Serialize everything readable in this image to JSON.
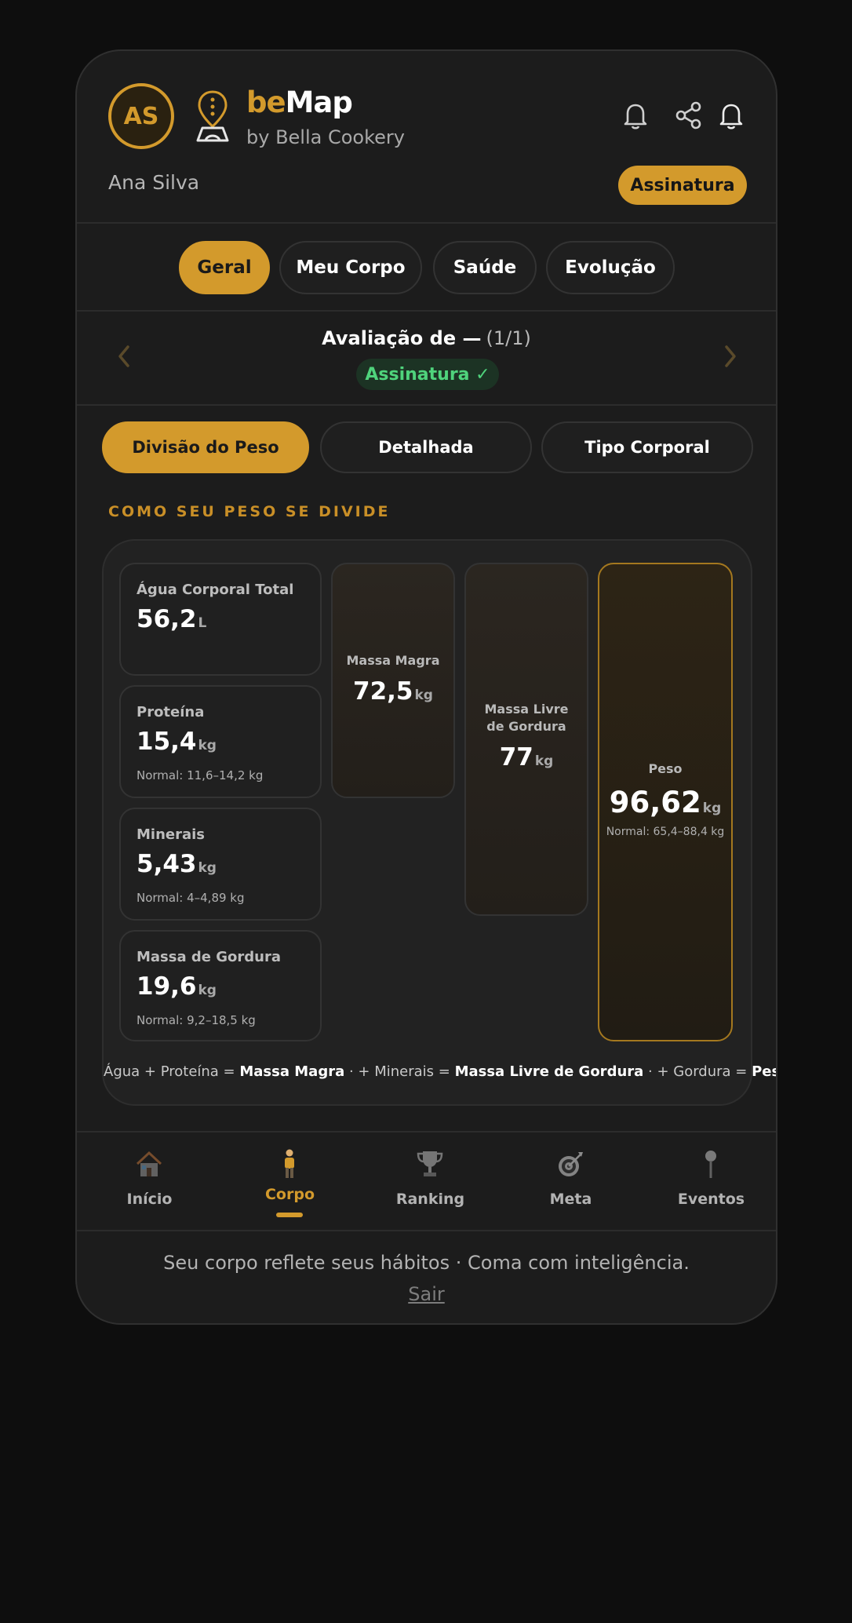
{
  "header": {
    "avatar_initials": "AS",
    "brand_prefix": "be",
    "brand_suffix": "Map",
    "byline": "by Bella Cookery",
    "user_name": "Ana Silva",
    "subscription_button": "Assinatura",
    "accent_color": "#d39a2c"
  },
  "tabs": [
    {
      "label": "Geral",
      "active": true
    },
    {
      "label": "Meu Corpo",
      "active": false
    },
    {
      "label": "Saúde",
      "active": false
    },
    {
      "label": "Evolução",
      "active": false
    }
  ],
  "evaluation": {
    "title": "Avaliação de —",
    "count": "(1/1)",
    "badge": "Assinatura ✓"
  },
  "subtabs": [
    {
      "label": "Divisão do Peso",
      "active": true
    },
    {
      "label": "Detalhada",
      "active": false
    },
    {
      "label": "Tipo Corporal",
      "active": false
    }
  ],
  "section_title": "COMO SEU PESO SE DIVIDE",
  "components": [
    {
      "label": "Água Corporal Total",
      "value": "56,2",
      "unit": "L",
      "normal": ""
    },
    {
      "label": "Proteína",
      "value": "15,4",
      "unit": "kg",
      "normal": "Normal: 11,6–14,2 kg"
    },
    {
      "label": "Minerais",
      "value": "5,43",
      "unit": "kg",
      "normal": "Normal: 4–4,89 kg"
    },
    {
      "label": "Massa de Gordura",
      "value": "19,6",
      "unit": "kg",
      "normal": "Normal: 9,2–18,5 kg"
    }
  ],
  "bars": [
    {
      "label": "Massa Magra",
      "value": "72,5",
      "unit": "kg",
      "normal": ""
    },
    {
      "label": "Massa Livre de Gordura",
      "value": "77",
      "unit": "kg",
      "normal": ""
    },
    {
      "label": "Peso",
      "value": "96,62",
      "unit": "kg",
      "normal": "Normal: 65,4–88,4 kg"
    }
  ],
  "formula": {
    "t1": "Água + Proteína = ",
    "b1": "Massa Magra",
    "t2": " · + Minerais = ",
    "b2": "Massa Livre de Gordura",
    "t3": " · + Gordura = ",
    "b3": "Peso"
  },
  "nav": [
    {
      "label": "Início",
      "icon": "house-icon",
      "active": false
    },
    {
      "label": "Corpo",
      "icon": "person-icon",
      "active": true
    },
    {
      "label": "Ranking",
      "icon": "trophy-icon",
      "active": false
    },
    {
      "label": "Meta",
      "icon": "target-icon",
      "active": false
    },
    {
      "label": "Eventos",
      "icon": "pin-icon",
      "active": false
    }
  ],
  "footer": {
    "tagline": "Seu corpo reflete seus hábitos · Coma com inteligência.",
    "logout": "Sair"
  }
}
